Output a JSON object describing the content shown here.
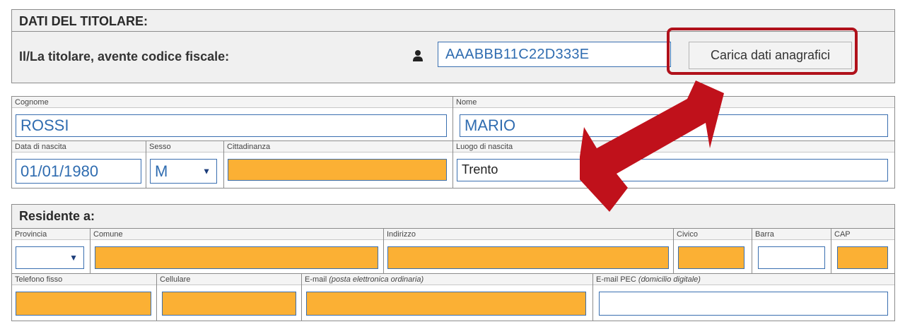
{
  "titolare": {
    "heading": "DATI DEL TITOLARE:",
    "cf_label": "Il/La titolare, avente codice fiscale:",
    "cf_value": "AAABBB11C22D333E",
    "carica_button": "Carica dati anagrafici",
    "icon": "user-icon"
  },
  "anagrafica": {
    "cognome_label": "Cognome",
    "cognome_value": "ROSSI",
    "nome_label": "Nome",
    "nome_value": "MARIO",
    "data_nascita_label": "Data di nascita",
    "data_nascita_value": "01/01/1980",
    "sesso_label": "Sesso",
    "sesso_value": "M",
    "cittadinanza_label": "Cittadinanza",
    "cittadinanza_value": "",
    "luogo_nascita_label": "Luogo di nascita",
    "luogo_nascita_value": "Trento"
  },
  "residenza": {
    "heading": "Residente a:",
    "provincia_label": "Provincia",
    "comune_label": "Comune",
    "indirizzo_label": "Indirizzo",
    "civico_label": "Civico",
    "barra_label": "Barra",
    "cap_label": "CAP",
    "telefono_label": "Telefono fisso",
    "cellulare_label": "Cellulare",
    "email_label": "E-mail",
    "email_note": "(posta elettronica ordinaria)",
    "pec_label": "E-mail PEC",
    "pec_note": "(domicilio digitale)"
  },
  "colors": {
    "required_field": "#fbb034",
    "field_border": "#3a6fb0",
    "highlight": "#b0111b"
  }
}
